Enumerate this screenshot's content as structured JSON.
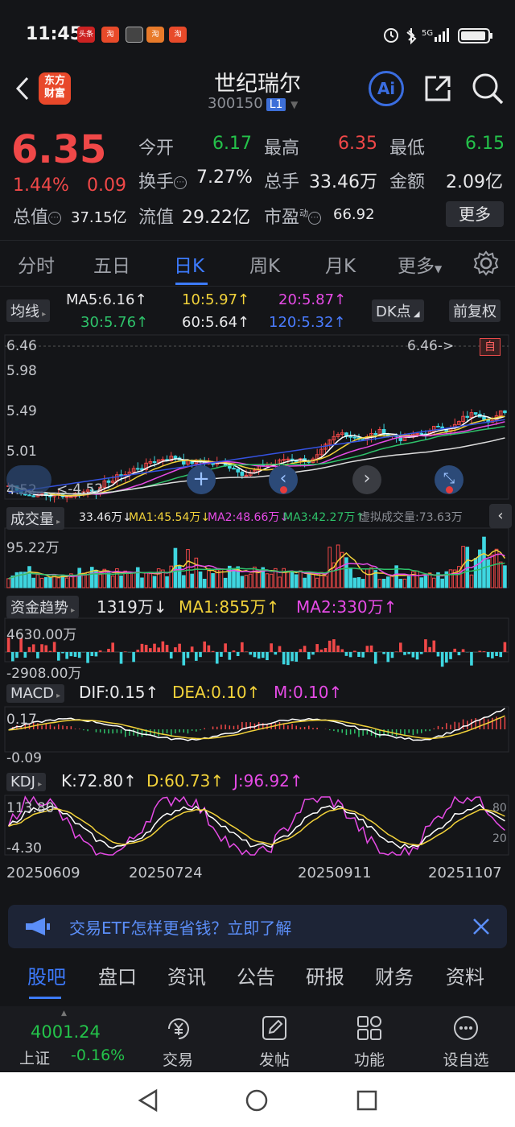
{
  "status_bar": {
    "time": "11:45",
    "app_badges": [
      "头条",
      "淘",
      "",
      "淘",
      "淘"
    ]
  },
  "header": {
    "logo_text": "东方\n财富",
    "name": "世纪瑞尔",
    "code": "300150",
    "level": "L1"
  },
  "quote": {
    "price": "6.35",
    "change_pct": "1.44%",
    "change": "0.09",
    "open_label": "今开",
    "open": "6.17",
    "high_label": "最高",
    "high": "6.35",
    "low_label": "最低",
    "low": "6.15",
    "turnover_label": "换手",
    "turnover": "7.27%",
    "volume_label": "总手",
    "volume": "33.46万",
    "amount_label": "金额",
    "amount": "2.09亿",
    "mktcap_label": "总值",
    "mktcap": "37.15亿",
    "float_label": "流值",
    "float_cap": "29.22亿",
    "pe_label": "市盈",
    "pe_sup": "动",
    "pe": "66.92",
    "more_label": "更多"
  },
  "period_tabs": [
    "分时",
    "五日",
    "日K",
    "周K",
    "月K",
    "更多"
  ],
  "active_period": "日K",
  "ma_bar": {
    "tag": "均线",
    "ma5": "MA5:6.16↑",
    "ma10": "10:5.97↑",
    "ma20": "20:5.87↑",
    "ma30": "30:5.76↑",
    "ma60": "60:5.64↑",
    "ma120": "120:5.32↑",
    "dk_label": "DK点",
    "adjust_label": "前复权"
  },
  "price_axis": [
    "6.46",
    "5.98",
    "5.49",
    "5.01",
    "4.52"
  ],
  "price_annotations": {
    "high": "6.46->",
    "low": "<-4.52",
    "self_tag": "自"
  },
  "volume_panel": {
    "tag": "成交量",
    "vol": "33.46万↓",
    "ma1": "MA1:45.54万↓",
    "ma2": "MA2:48.66万↓",
    "ma3": "MA3:42.27万↑",
    "virtual": "虚拟成交量:73.63万",
    "axis_max": "95.22万"
  },
  "fund_panel": {
    "tag": "资金趋势",
    "value": "1319万↓",
    "ma1": "MA1:855万↑",
    "ma2": "MA2:330万↑",
    "axis_max": "4630.00万",
    "axis_min": "-2908.00万"
  },
  "macd_panel": {
    "tag": "MACD",
    "dif": "DIF:0.15↑",
    "dea": "DEA:0.10↑",
    "m": "M:0.10↑",
    "axis_max": "0.17",
    "axis_min": "-0.09"
  },
  "kdj_panel": {
    "tag": "KDJ",
    "k": "K:72.80↑",
    "d": "D:60.73↑",
    "j": "J:96.92↑",
    "axis_max": "113.80",
    "axis_min": "-4.30",
    "right_top": "80",
    "right_bottom": "20"
  },
  "date_axis": [
    "20250609",
    "20250724",
    "20250911",
    "20251107"
  ],
  "ad": {
    "text": "交易ETF怎样更省钱？立即了解"
  },
  "bottom_tabs": [
    "股吧",
    "盘口",
    "资讯",
    "公告",
    "研报",
    "财务",
    "资料"
  ],
  "active_bottom_tab": "股吧",
  "toolbar": {
    "index_value": "4001.24",
    "index_name": "上证",
    "index_change": "-0.16%",
    "trade": "交易",
    "post": "发帖",
    "functions": "功能",
    "watchlist": "设自选"
  },
  "colors": {
    "up": "#f04848",
    "down": "#3ed6e0",
    "accent": "#3d7bff",
    "ma5": "#ffffff",
    "ma10": "#f2d23a",
    "ma20": "#e64be6",
    "ma30": "#2ec26a",
    "ma60": "#dddddd",
    "ma120": "#3552e0"
  }
}
